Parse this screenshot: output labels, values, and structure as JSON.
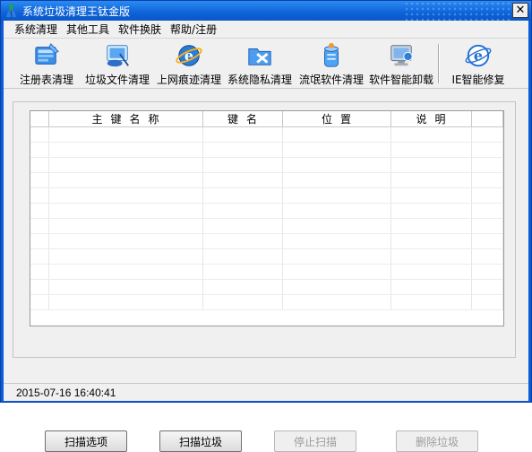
{
  "window": {
    "title": "系统垃圾清理王钛金版",
    "close_glyph": "✕"
  },
  "menu": [
    "系统清理",
    "其他工具",
    "软件换肤",
    "帮助/注册"
  ],
  "toolbar": [
    {
      "label": "注册表清理",
      "icon": "registry-cleanup-icon"
    },
    {
      "label": "垃圾文件清理",
      "icon": "junk-file-cleanup-icon"
    },
    {
      "label": "上网痕迹清理",
      "icon": "internet-traces-icon"
    },
    {
      "label": "系统隐私清理",
      "icon": "privacy-cleanup-icon"
    },
    {
      "label": "流氓软件清理",
      "icon": "rogue-software-icon"
    },
    {
      "label": "软件智能卸载",
      "icon": "smart-uninstall-icon"
    },
    {
      "label": "IE智能修复",
      "icon": "ie-repair-icon"
    }
  ],
  "table": {
    "columns": [
      "",
      "主键名称",
      "键名",
      "位置",
      "说明",
      ""
    ],
    "empty_rows": 12
  },
  "buttons": {
    "scan_options": "扫描选项",
    "scan_junk": "扫描垃圾",
    "stop_scan": "停止扫描",
    "delete_junk": "删除垃圾"
  },
  "status": {
    "datetime": "2015-07-16 16:40:41"
  }
}
